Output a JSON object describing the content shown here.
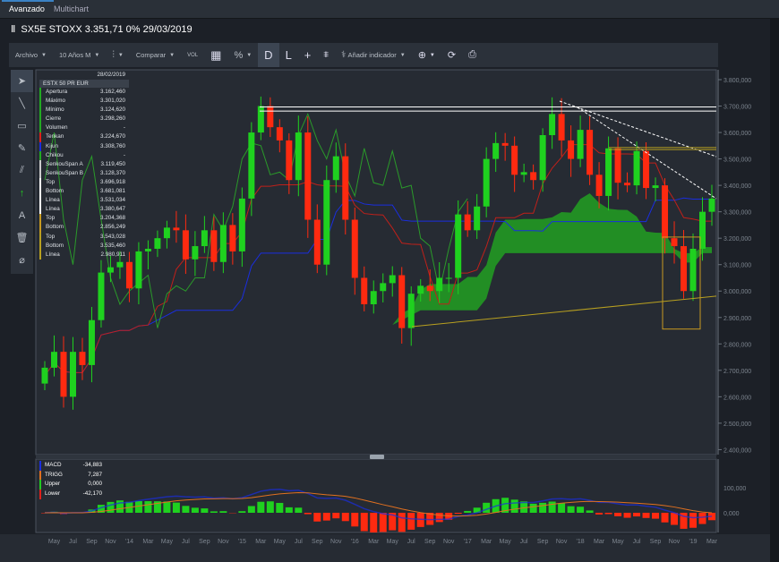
{
  "tabs": [
    {
      "label": "Avanzado",
      "active": true
    },
    {
      "label": "Multichart",
      "active": false
    }
  ],
  "header": {
    "title": "SX5E STOXX 3.351,71 0% 29/03/2019",
    "icon": "candlestick-icon"
  },
  "toolbar": {
    "archivo": "Archivo",
    "period": "10 Años M",
    "compare": "Comparar",
    "vol": "VOL",
    "percent": "%",
    "d": "D",
    "l": "L",
    "add_indicator": "Añadir indicador"
  },
  "left_tools": [
    "cursor-icon",
    "line-icon",
    "rectangle-icon",
    "pen-icon",
    "parallel-lines-icon",
    "arrow-up-icon",
    "text-icon",
    "trash-icon",
    "eraser-icon"
  ],
  "info_panel": {
    "date": "28/02/2019",
    "symbol": "ESTX 50 PR EUR",
    "rows": [
      {
        "label": "Apertura",
        "value": "3.162,460",
        "color": "#22aa22"
      },
      {
        "label": "Máximo",
        "value": "3.301,020",
        "color": "#22aa22"
      },
      {
        "label": "Mínimo",
        "value": "3.124,620",
        "color": "#22aa22"
      },
      {
        "label": "Cierre",
        "value": "3.298,260",
        "color": "#22aa22"
      },
      {
        "label": "Volumen",
        "value": "-",
        "color": "#22aa22"
      },
      {
        "label": "Tenkan",
        "value": "3.224,670",
        "color": "#e0201a"
      },
      {
        "label": "Kijun",
        "value": "3.308,760",
        "color": "#1a2ee0"
      },
      {
        "label": "Chikou",
        "value": "-",
        "color": "#22aa22"
      },
      {
        "label": "SenkouSpan A",
        "value": "3.119,450",
        "color": "#cccccc"
      },
      {
        "label": "SenkouSpan B",
        "value": "3.128,370",
        "color": "#cccccc"
      },
      {
        "label": "Top",
        "value": "3.696,918",
        "color": "#ffffff"
      },
      {
        "label": "Bottom",
        "value": "3.681,081",
        "color": "#ffffff"
      },
      {
        "label": "Línea",
        "value": "3.531,034",
        "color": "#ffffff"
      },
      {
        "label": "Línea",
        "value": "3.380,647",
        "color": "#ffffff"
      },
      {
        "label": "Top",
        "value": "3.204,368",
        "color": "#c89a20"
      },
      {
        "label": "Bottom",
        "value": "2.856,249",
        "color": "#c89a20"
      },
      {
        "label": "Top",
        "value": "3.543,028",
        "color": "#b8a020"
      },
      {
        "label": "Bottom",
        "value": "3.535,460",
        "color": "#b8a020"
      },
      {
        "label": "Línea",
        "value": "2.980,911",
        "color": "#b8a020"
      }
    ]
  },
  "macd_panel": {
    "rows": [
      {
        "label": "MACD",
        "value": "-34,883",
        "color": "#1a2ee0"
      },
      {
        "label": "TRIGG",
        "value": "7,287",
        "color": "#e07020"
      },
      {
        "label": "Upper",
        "value": "0,000",
        "color": "#22cc22"
      },
      {
        "label": "Lower",
        "value": "-42,170",
        "color": "#e0201a"
      }
    ],
    "axis": [
      "100,000",
      "0,000"
    ]
  },
  "chart_data": {
    "type": "candlestick",
    "symbol": "SX5E",
    "interval": "monthly",
    "start": "2013-04",
    "closes": [
      2710,
      2770,
      2600,
      2770,
      2720,
      2890,
      3070,
      3090,
      3110,
      3010,
      3150,
      3160,
      3200,
      3240,
      3230,
      3120,
      3170,
      3230,
      3110,
      3250,
      3150,
      3350,
      3600,
      3700,
      3620,
      3570,
      3420,
      3600,
      3270,
      3100,
      3420,
      3510,
      3270,
      3050,
      2950,
      3000,
      3030,
      3060,
      2860,
      2990,
      3020,
      3000,
      3050,
      3050,
      3290,
      3230,
      3320,
      3500,
      3560,
      3550,
      3440,
      3450,
      3420,
      3590,
      3670,
      3570,
      3500,
      3610,
      3440,
      3360,
      3540,
      3410,
      3400,
      3530,
      3390,
      3400,
      3200,
      3170,
      3000,
      3160,
      3300,
      3350
    ],
    "y_ticks": [
      "3.800,000",
      "3.700,000",
      "3.600,000",
      "3.500,000",
      "3.400,000",
      "3.300,000",
      "3.200,000",
      "3.100,000",
      "3.000,000",
      "2.900,000",
      "2.800,000",
      "2.700,000",
      "2.600,000",
      "2.500,000",
      "2.400,000"
    ],
    "y_tick_values": [
      3800,
      3700,
      3600,
      3500,
      3400,
      3300,
      3200,
      3100,
      3000,
      2900,
      2800,
      2700,
      2600,
      2500,
      2400
    ],
    "x_labels": [
      "May",
      "Jul",
      "Sep",
      "Nov",
      "'14",
      "Mar",
      "May",
      "Jul",
      "Sep",
      "Nov",
      "'15",
      "Mar",
      "May",
      "Jul",
      "Sep",
      "Nov",
      "'16",
      "Mar",
      "May",
      "Jul",
      "Sep",
      "Nov",
      "'17",
      "Mar",
      "May",
      "Jul",
      "Sep",
      "Nov",
      "'18",
      "Mar",
      "May",
      "Jul",
      "Sep",
      "Nov",
      "'19",
      "Mar"
    ],
    "levels": {
      "white_top": 3696.918,
      "white_bottom": 3681.081,
      "yellow_top": 3543.028,
      "yellow_bottom": 3535.46,
      "box_top": 3204.368,
      "box_bottom": 2856.249,
      "line_end": 2980.911
    },
    "colors": {
      "up": "#1fd11f",
      "down": "#ff2a10",
      "tenkan": "#c0201a",
      "kijun": "#1a2ee0",
      "chikou": "#2a9a2a",
      "cloud": "#22a022"
    }
  }
}
